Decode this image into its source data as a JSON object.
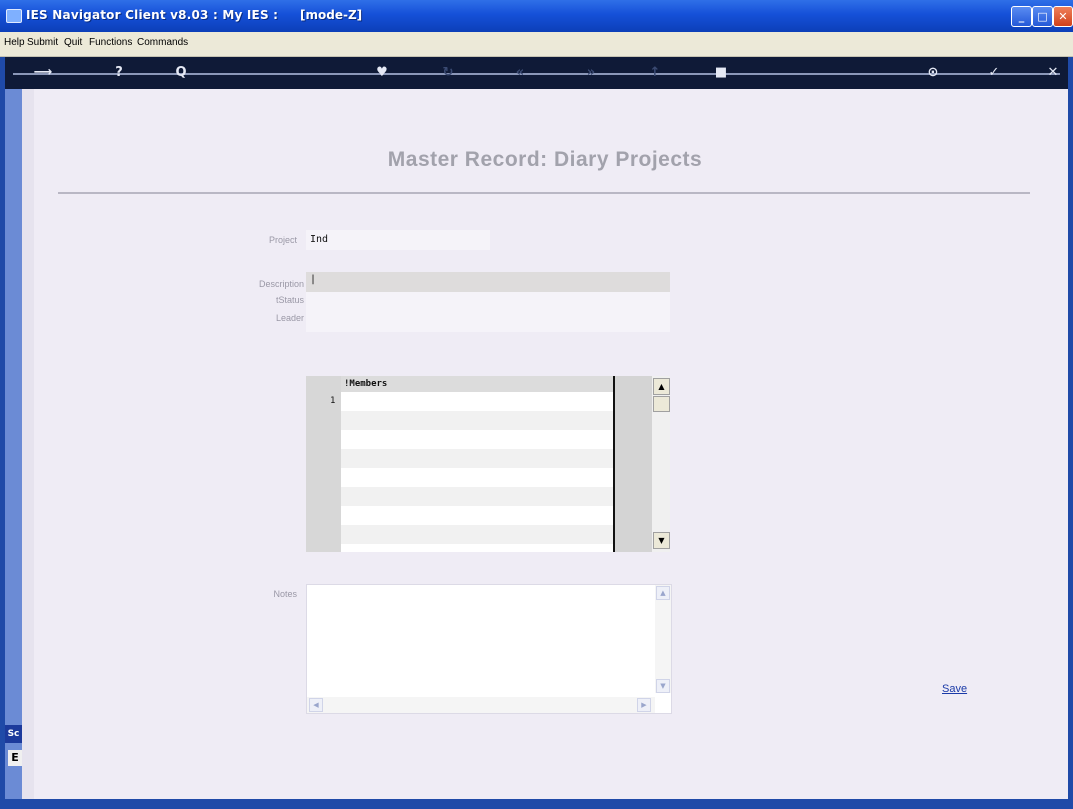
{
  "window": {
    "title": "IES Navigator Client v8.03 : My IES :",
    "mode": "[mode-Z]"
  },
  "menu": [
    "Help",
    "Submit",
    "Quit",
    "Functions",
    "Commands"
  ],
  "toolbar": {
    "icons": [
      "back-icon",
      "help-icon",
      "search-icon",
      "heart-icon",
      "refresh-icon",
      "rewind-icon",
      "forward-icon",
      "up-icon",
      "stop-icon",
      "menu-icon",
      "ok-icon",
      "close-icon"
    ],
    "glyphs": [
      "⟶",
      "?",
      "Q",
      "♥",
      "↻",
      "«",
      "»",
      "↑",
      "■",
      "⊙",
      "✓",
      "✕"
    ]
  },
  "sidebar": {
    "tab_label": "Sc",
    "tab2_label": "E"
  },
  "page": {
    "title": "Master Record: Diary Projects"
  },
  "form": {
    "project_label": "Project",
    "project_value": "Ind",
    "description_label": "Description",
    "description_value": "|",
    "status_label": "tStatus",
    "leader_label": "Leader",
    "notes_label": "Notes"
  },
  "members_grid": {
    "column_header": "!Members",
    "rows": [
      "1"
    ]
  },
  "actions": {
    "save_label": "Save"
  },
  "colors": {
    "titlebar": "#1550d8",
    "content_bg": "#efecf5",
    "toolbar_bg": "#0f1a37",
    "title_text": "#a2a2ac",
    "link": "#1a3aa8"
  }
}
